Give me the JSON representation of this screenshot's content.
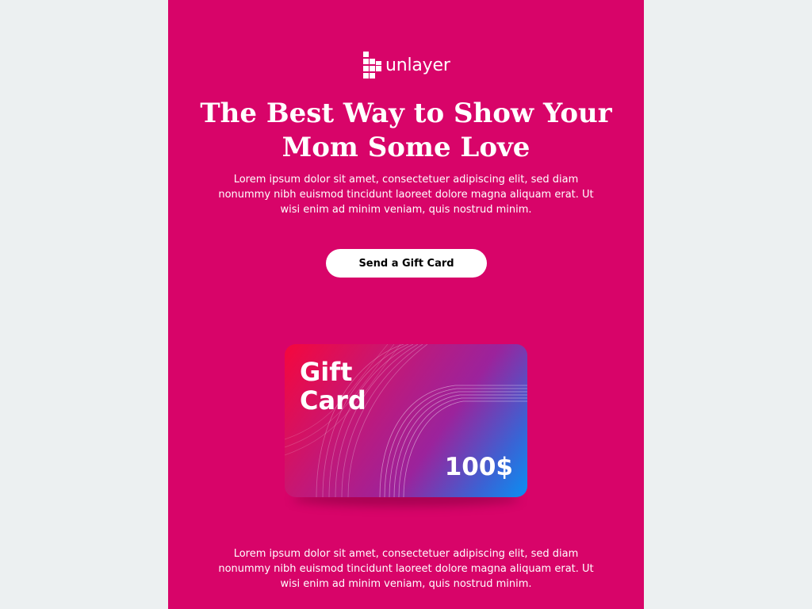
{
  "brand": {
    "logo_text": "unlayer",
    "logo_icon": "unlayer-grid-icon"
  },
  "hero": {
    "headline": "The Best Way to Show Your Mom Some Love",
    "intro": "Lorem ipsum dolor sit amet, consectetuer adipiscing elit, sed diam nonummy nibh euismod tincidunt laoreet dolore magna aliquam erat. Ut wisi enim ad minim veniam, quis nostrud minim."
  },
  "cta": {
    "label": "Send a Gift Card"
  },
  "gift_card": {
    "title": "Gift\nCard",
    "amount": "100$"
  },
  "footer": {
    "text": "Lorem ipsum dolor sit amet, consectetuer adipiscing elit, sed diam nonummy nibh euismod tincidunt laoreet dolore magna aliquam erat. Ut wisi enim ad minim veniam, quis nostrud minim."
  },
  "colors": {
    "page_background": "#ecf0f1",
    "email_background": "#d80469",
    "button_background": "#ffffff",
    "text": "#ffffff"
  }
}
